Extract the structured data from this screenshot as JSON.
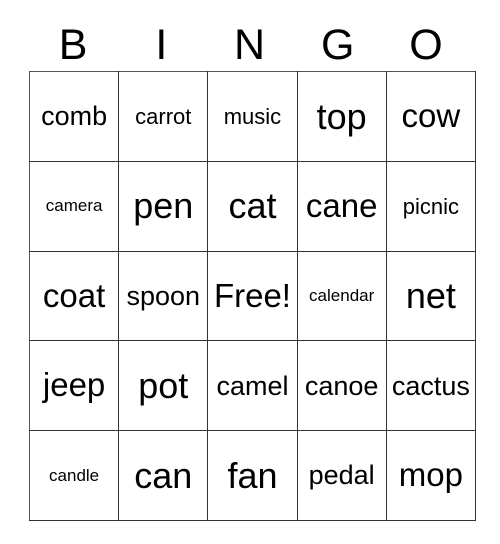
{
  "card": {
    "title": "BINGO",
    "header_letters": [
      "B",
      "I",
      "N",
      "G",
      "O"
    ],
    "free_space_label": "Free!",
    "free_space_position": {
      "row": 3,
      "column": 3
    },
    "grid_size": "5x5",
    "colors": {
      "background": "#ffffff",
      "text": "#000000",
      "grid_line": "#333333"
    },
    "rows": [
      {
        "cells": [
          {
            "text": "comb",
            "size": "md"
          },
          {
            "text": "carrot",
            "size": "sm"
          },
          {
            "text": "music",
            "size": "sm"
          },
          {
            "text": "top",
            "size": "xl"
          },
          {
            "text": "cow",
            "size": "lg"
          }
        ]
      },
      {
        "cells": [
          {
            "text": "camera",
            "size": "xs"
          },
          {
            "text": "pen",
            "size": "xl"
          },
          {
            "text": "cat",
            "size": "xl"
          },
          {
            "text": "cane",
            "size": "lg"
          },
          {
            "text": "picnic",
            "size": "sm"
          }
        ]
      },
      {
        "cells": [
          {
            "text": "coat",
            "size": "lg"
          },
          {
            "text": "spoon",
            "size": "md"
          },
          {
            "text": "Free!",
            "size": "lg"
          },
          {
            "text": "calendar",
            "size": "xs"
          },
          {
            "text": "net",
            "size": "xl"
          }
        ]
      },
      {
        "cells": [
          {
            "text": "jeep",
            "size": "lg"
          },
          {
            "text": "pot",
            "size": "xl"
          },
          {
            "text": "camel",
            "size": "md"
          },
          {
            "text": "canoe",
            "size": "md"
          },
          {
            "text": "cactus",
            "size": "md"
          }
        ]
      },
      {
        "cells": [
          {
            "text": "candle",
            "size": "xs"
          },
          {
            "text": "can",
            "size": "xl"
          },
          {
            "text": "fan",
            "size": "xl"
          },
          {
            "text": "pedal",
            "size": "md"
          },
          {
            "text": "mop",
            "size": "lg"
          }
        ]
      }
    ]
  }
}
